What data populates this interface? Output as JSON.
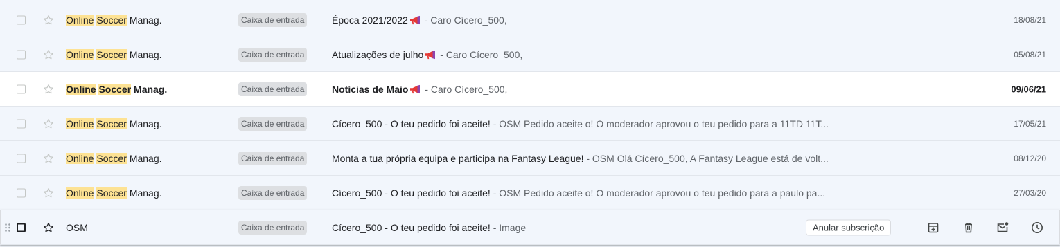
{
  "messages": [
    {
      "sender_pre": "Online",
      "sender_sp": " ",
      "sender_mid": "Soccer",
      "sender_post": " Manag.",
      "label": "Caixa de entrada",
      "subject": "Época 2021/2022",
      "has_emoji": true,
      "snippet": " - Caro Cícero_500,",
      "date": "18/08/21",
      "unread": false
    },
    {
      "sender_pre": "Online",
      "sender_sp": " ",
      "sender_mid": "Soccer",
      "sender_post": " Manag.",
      "label": "Caixa de entrada",
      "subject": "Atualizações de julho",
      "has_emoji": true,
      "snippet": " - Caro Cícero_500,",
      "date": "05/08/21",
      "unread": false
    },
    {
      "sender_pre": "Online",
      "sender_sp": " ",
      "sender_mid": "Soccer",
      "sender_post": " Manag.",
      "label": "Caixa de entrada",
      "subject": "Notícias de Maio",
      "has_emoji": true,
      "snippet": " - Caro Cícero_500,",
      "date": "09/06/21",
      "unread": true
    },
    {
      "sender_pre": "Online",
      "sender_sp": " ",
      "sender_mid": "Soccer",
      "sender_post": " Manag.",
      "label": "Caixa de entrada",
      "subject": "Cícero_500 - O teu pedido foi aceite!",
      "has_emoji": false,
      "snippet": " - OSM Pedido aceite o! O moderador aprovou o teu pedido para a 11TD 11T...",
      "date": "17/05/21",
      "unread": false
    },
    {
      "sender_pre": "Online",
      "sender_sp": " ",
      "sender_mid": "Soccer",
      "sender_post": " Manag.",
      "label": "Caixa de entrada",
      "subject": "Monta a tua própria equipa e participa na Fantasy League!",
      "has_emoji": false,
      "snippet": " - OSM Olá Cícero_500, A Fantasy League está de volt...",
      "date": "08/12/20",
      "unread": false
    },
    {
      "sender_pre": "Online",
      "sender_sp": " ",
      "sender_mid": "Soccer",
      "sender_post": " Manag.",
      "label": "Caixa de entrada",
      "subject": "Cícero_500 - O teu pedido foi aceite!",
      "has_emoji": false,
      "snippet": " - OSM Pedido aceite o! O moderador aprovou o teu pedido para a paulo pa...",
      "date": "27/03/20",
      "unread": false
    }
  ],
  "hovered": {
    "sender": "OSM",
    "label": "Caixa de entrada",
    "subject": "Cícero_500 - O teu pedido foi aceite!",
    "snippet": " - Image",
    "unsubscribe_label": "Anular subscrição"
  },
  "icons": {
    "archive": "archive-icon",
    "delete": "trash-icon",
    "mark_unread": "mark-unread-icon",
    "snooze": "clock-icon",
    "announcement": "megaphone-emoji"
  },
  "colors": {
    "highlight": "#fde293",
    "unread_bg": "#ffffff",
    "read_bg": "#f2f6fc"
  }
}
